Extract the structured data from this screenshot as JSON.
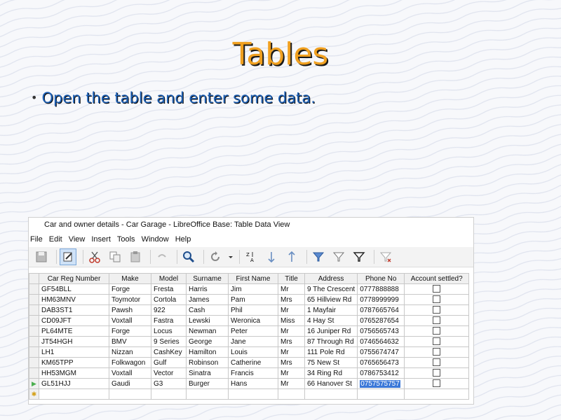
{
  "slide": {
    "title": "Tables",
    "bullet": "Open the table and enter some data."
  },
  "window": {
    "title": "Car and owner details - Car Garage - LibreOffice Base: Table Data View",
    "menu": [
      "File",
      "Edit",
      "View",
      "Insert",
      "Tools",
      "Window",
      "Help"
    ]
  },
  "toolbar": {
    "icons": [
      "save-icon",
      "edit-icon",
      "cut-icon",
      "copy-icon",
      "paste-icon",
      "undo-icon",
      "find-icon",
      "refresh-icon",
      "sort-icon",
      "sort-ascending-icon",
      "sort-descending-icon",
      "autofilter-icon",
      "standard-filter-icon",
      "apply-filter-icon",
      "reset-filter-icon"
    ]
  },
  "table": {
    "columns": [
      "Car Reg Number",
      "Make",
      "Model",
      "Surname",
      "First Name",
      "Title",
      "Address",
      "Phone No",
      "Account settled?"
    ],
    "rows": [
      [
        "GF54BLL",
        "Forge",
        "Fresta",
        "Harris",
        "Jim",
        "Mr",
        "9 The Crescent",
        "0777888888"
      ],
      [
        "HM63MNV",
        "Toymotor",
        "Cortola",
        "James",
        "Pam",
        "Mrs",
        "65 Hillview Rd",
        "0778999999"
      ],
      [
        "DAB3ST1",
        "Pawsh",
        "922",
        "Cash",
        "Phil",
        "Mr",
        "1 Mayfair",
        "0787665764"
      ],
      [
        "CD09JFT",
        "Voxtall",
        "Fastra",
        "Lewski",
        "Weronica",
        "Miss",
        "4 Hay St",
        "0765287654"
      ],
      [
        "PL64MTE",
        "Forge",
        "Locus",
        "Newman",
        "Peter",
        "Mr",
        "16 Juniper Rd",
        "0756565743"
      ],
      [
        "JT54HGH",
        "BMV",
        "9 Series",
        "George",
        "Jane",
        "Mrs",
        "87 Through Rd",
        "0746564632"
      ],
      [
        "LH1",
        "Nizzan",
        "CashKey",
        "Hamilton",
        "Louis",
        "Mr",
        "111 Pole Rd",
        "0755674747"
      ],
      [
        "KM65TPP",
        "Folkwagon",
        "Gulf",
        "Robinson",
        "Catherine",
        "Mrs",
        "75 New St",
        "0765656473"
      ],
      [
        "HH53MGM",
        "Voxtall",
        "Vector",
        "Sinatra",
        "Francis",
        "Mr",
        "34 Ring Rd",
        "0786753412"
      ],
      [
        "GL51HJJ",
        "Gaudi",
        "G3",
        "Burger",
        "Hans",
        "Mr",
        "66 Hanover St",
        "0757575757"
      ]
    ]
  }
}
